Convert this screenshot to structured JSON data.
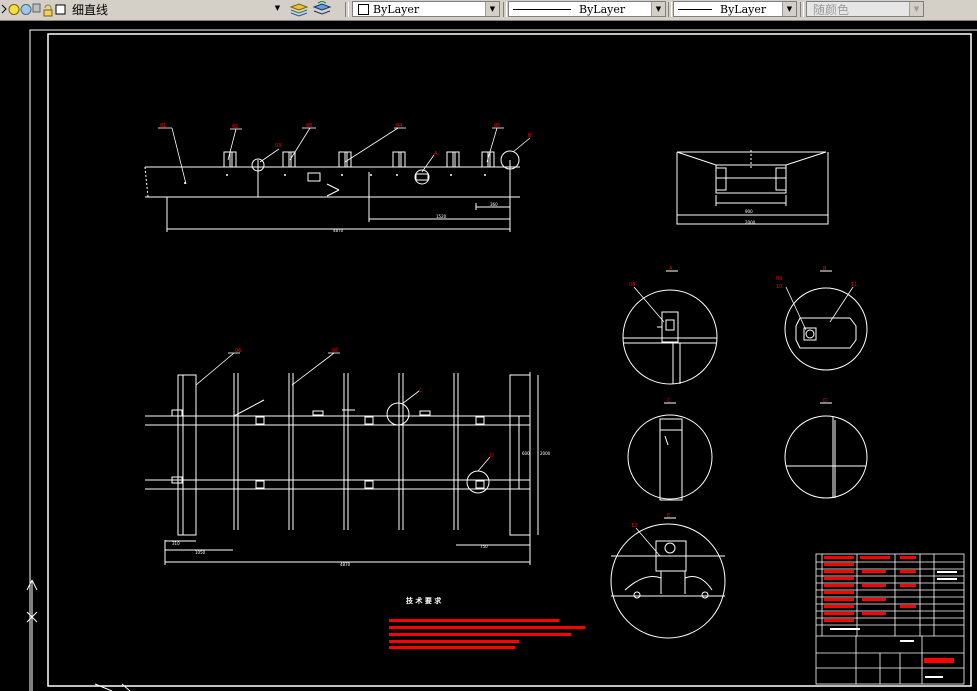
{
  "toolbar": {
    "layer_name": "细直线",
    "color_value": "ByLayer",
    "linetype_value": "ByLayer",
    "lineweight_value": "ByLayer",
    "plotstyle_value": "随颜色"
  },
  "drawing": {
    "tech_requirements_title": "技 术 要 求",
    "colors": {
      "background": "#000000",
      "lines": "#ffffff",
      "annotations": "#ff0000",
      "toolbar": "#d4d0c8"
    }
  }
}
